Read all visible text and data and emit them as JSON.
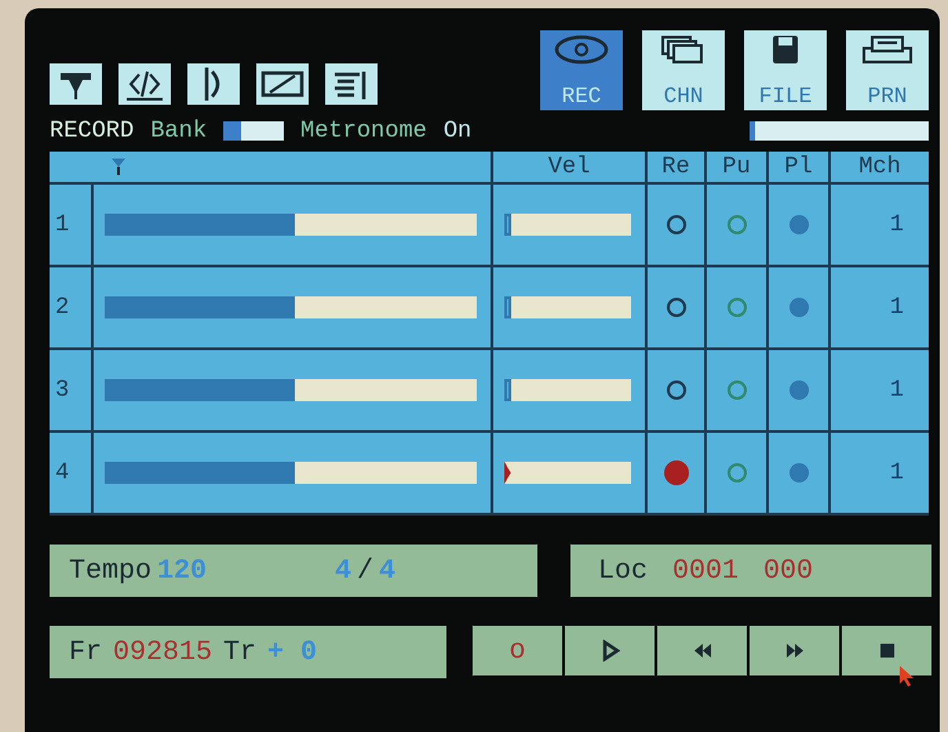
{
  "modes": [
    {
      "kind": "rec",
      "label": "REC",
      "selected": true
    },
    {
      "kind": "chn",
      "label": "CHN",
      "selected": false
    },
    {
      "kind": "file",
      "label": "FILE",
      "selected": false
    },
    {
      "kind": "prn",
      "label": "PRN",
      "selected": false
    }
  ],
  "status": {
    "mode": "RECORD",
    "bank_label": "Bank",
    "bank_indicator": {
      "level": 0.3
    },
    "metronome_label": "Metronome",
    "metronome_value": "On",
    "metronome_meter": {
      "level": 0.03
    }
  },
  "table": {
    "columns": [
      "Vel",
      "Re",
      "Pu",
      "Pl",
      "Mch"
    ],
    "rows": [
      {
        "number": "1",
        "level": 0.51,
        "velocity": {
          "level": 0.03
        },
        "record": false,
        "punch": false,
        "play": true,
        "channel": "1"
      },
      {
        "number": "2",
        "level": 0.51,
        "velocity": {
          "level": 0.03
        },
        "record": false,
        "punch": false,
        "play": true,
        "channel": "1"
      },
      {
        "number": "3",
        "level": 0.51,
        "velocity": {
          "level": 0.03
        },
        "record": false,
        "punch": false,
        "play": true,
        "channel": "1"
      },
      {
        "number": "4",
        "level": 0.51,
        "velocity": {
          "level": 0.03
        },
        "record": true,
        "punch": false,
        "play": true,
        "channel": "1"
      }
    ]
  },
  "tempo": {
    "label": "Tempo",
    "value": "120",
    "numerator": "4",
    "separator": "/",
    "denominator": "4"
  },
  "location": {
    "label": "Loc",
    "bar": "0001",
    "tick": "000"
  },
  "frame": {
    "label": "Fr",
    "value": "092815",
    "track_label": "Tr",
    "track_value": "+ 0"
  },
  "transport": [
    {
      "kind": "record",
      "label": "o"
    },
    {
      "kind": "play"
    },
    {
      "kind": "rewind"
    },
    {
      "kind": "forward"
    },
    {
      "kind": "stop"
    }
  ]
}
